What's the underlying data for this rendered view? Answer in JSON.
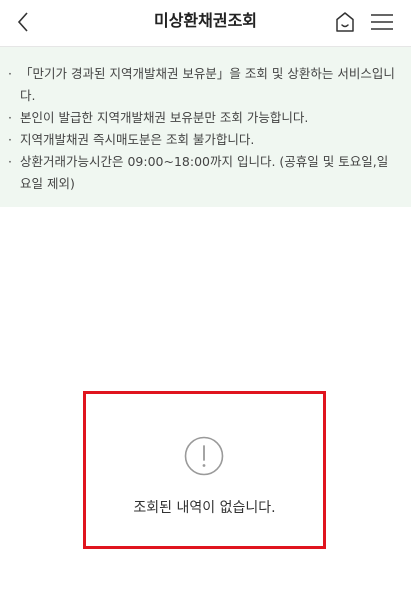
{
  "header": {
    "title": "미상환채권조회",
    "back_icon": "chevron-left-icon",
    "home_icon": "home-icon",
    "menu_icon": "hamburger-menu-icon"
  },
  "notice": {
    "bullet": "·",
    "items": [
      {
        "text": "「만기가 경과된 지역개발채권 보유분」을 조회 및 상환하는 서비스입니다."
      },
      {
        "text": "본인이 발급한 지역개발채권 보유분만 조회 가능합니다."
      },
      {
        "text": "지역개발채권 즉시매도분은 조회 불가합니다."
      },
      {
        "text": "상환거래가능시간은 09:00~18:00까지 입니다. (공휴일 및 토요일,일요일 제외)"
      }
    ],
    "background_color": "#f0f7f1"
  },
  "empty_state": {
    "icon": "exclamation-circle-icon",
    "message": "조회된 내역이 없습니다.",
    "highlight_color": "#e0141e"
  }
}
